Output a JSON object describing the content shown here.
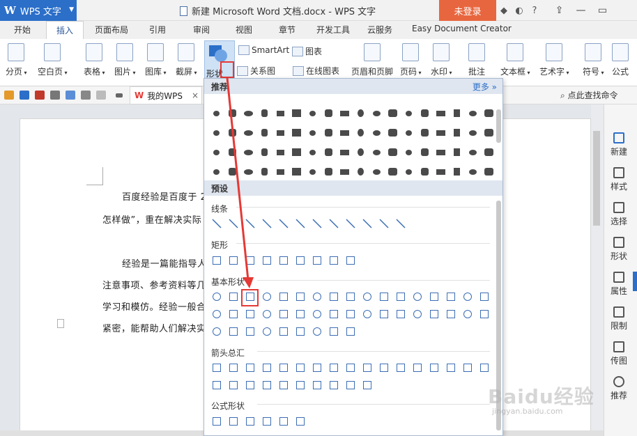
{
  "titlebar": {
    "app_name": "WPS 文字",
    "window_title": "新建 Microsoft Word 文档.docx - WPS 文字",
    "login_label": "未登录"
  },
  "tabs": [
    {
      "label": "开始"
    },
    {
      "label": "插入"
    },
    {
      "label": "页面布局"
    },
    {
      "label": "引用"
    },
    {
      "label": "审阅"
    },
    {
      "label": "视图"
    },
    {
      "label": "章节"
    },
    {
      "label": "开发工具"
    },
    {
      "label": "云服务"
    },
    {
      "label": "Easy Document Creator"
    }
  ],
  "ribbon": {
    "page_break": "分页",
    "blank_page": "空白页",
    "table": "表格",
    "picture": "图片",
    "gallery": "图库",
    "screenshot": "截屏",
    "shapes": "形状",
    "smartart": "SmartArt",
    "chart": "图表",
    "relation": "关系图",
    "online_chart": "在线图表",
    "header_footer": "页眉和页脚",
    "page_number": "页码",
    "watermark": "水印",
    "comment": "批注",
    "textbox": "文本框",
    "wordart": "艺术字",
    "symbol": "符号",
    "formula": "公式"
  },
  "quickaccess": {
    "mywps": "我的WPS",
    "find_cmd": "点此查找命令"
  },
  "document": {
    "p1": "百度经验是百度于 2",
    "p2": "怎样做”，重在解决实际",
    "p3": "经验是一篇能指导人",
    "p4": "注意事项、参考资料等几",
    "p5": "学习和模仿。经验一般合",
    "p6": "紧密，能帮助人们解决实"
  },
  "shapes_panel": {
    "recommended": "推荐",
    "more": "更多",
    "presets": "预设",
    "lines": "线条",
    "rectangles": "矩形",
    "basic_shapes": "基本形状",
    "block_arrows": "箭头总汇",
    "equation_shapes": "公式形状"
  },
  "right_panel": [
    "新建",
    "样式",
    "选择",
    "形状",
    "属性",
    "限制",
    "传图",
    "推荐"
  ],
  "watermark": {
    "brand": "Baidu经验",
    "url": "jingyan.baidu.com"
  },
  "colors": {
    "accent": "#2b6fc9",
    "login": "#e8663f",
    "highlight": "#e53935"
  }
}
